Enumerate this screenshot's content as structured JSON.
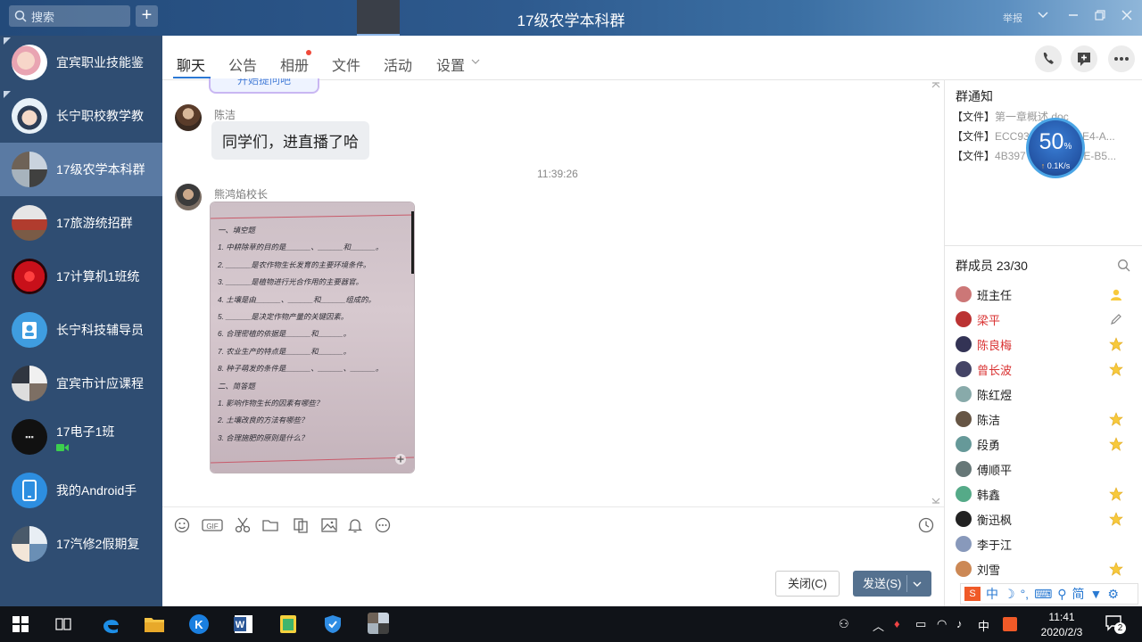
{
  "window": {
    "title": "17级农学本科群",
    "report_label": "举报"
  },
  "search": {
    "placeholder": "搜索"
  },
  "sidebar": {
    "items": [
      {
        "name": "宜宾职业技能鉴"
      },
      {
        "name": "长宁职校教学教"
      },
      {
        "name": "17级农学本科群"
      },
      {
        "name": "17旅游统招群"
      },
      {
        "name": "17计算机1班统"
      },
      {
        "name": "长宁科技辅导员"
      },
      {
        "name": "宜宾市计应课程"
      },
      {
        "name": "17电子1班"
      },
      {
        "name": "我的Android手"
      },
      {
        "name": "17汽修2假期复"
      }
    ]
  },
  "tabs": [
    {
      "label": "聊天"
    },
    {
      "label": "公告"
    },
    {
      "label": "相册"
    },
    {
      "label": "文件"
    },
    {
      "label": "活动"
    },
    {
      "label": "设置"
    }
  ],
  "chat": {
    "top_hint": "开始提问吧",
    "messages": [
      {
        "sender": "陈洁",
        "text": "同学们，进直播了哈"
      },
      {
        "time": "11:39:26"
      },
      {
        "sender": "熊鸿焰校长",
        "image": "handwritten-worksheet"
      }
    ],
    "worksheet_lines": [
      "一、填空题",
      "1. 中耕除草的目的是______、______和______。",
      "2. ______是农作物生长发育的主要环境条件。",
      "3. ______是植物进行光合作用的主要器官。",
      "4. 土壤是由______、______和______组成的。",
      "5. ______是决定作物产量的关键因素。",
      "6. 合理密植的依据是______和______。",
      "7. 农业生产的特点是______和______。",
      "8. 种子萌发的条件是______、______、______。",
      "二、简答题",
      "1. 影响作物生长的因素有哪些？",
      "2. 土壤改良的方法有哪些？",
      "3. 合理施肥的原则是什么？"
    ]
  },
  "composer": {
    "close_label": "关闭(C)",
    "send_label": "发送(S)"
  },
  "notice": {
    "title": "群通知",
    "items": [
      {
        "tag": "【文件】",
        "name": "第一章概述.doc"
      },
      {
        "tag": "【文件】",
        "name": "ECC93",
        "tail": "48E4-A..."
      },
      {
        "tag": "【文件】",
        "name": "4B397",
        "tail": "3BE-B5..."
      }
    ]
  },
  "speed": {
    "percent": "50",
    "percent_unit": "%",
    "rate": "0.1K/s"
  },
  "members": {
    "title": "群成员 23/30",
    "list": [
      {
        "name": "班主任",
        "color": "#222"
      },
      {
        "name": "梁平",
        "color": "#d93232"
      },
      {
        "name": "陈良梅",
        "color": "#d93232"
      },
      {
        "name": "曾长波",
        "color": "#d93232"
      },
      {
        "name": "陈红煜",
        "color": "#222"
      },
      {
        "name": "陈洁",
        "color": "#222"
      },
      {
        "name": "段勇",
        "color": "#222"
      },
      {
        "name": "傅顺平",
        "color": "#222"
      },
      {
        "name": "韩鑫",
        "color": "#222"
      },
      {
        "name": "衡迅枫",
        "color": "#222"
      },
      {
        "name": "李于江",
        "color": "#222"
      },
      {
        "name": "刘雪",
        "color": "#222"
      }
    ]
  },
  "ime": {
    "lang": "中",
    "simplified": "简"
  },
  "taskbar": {
    "time": "11:41",
    "date": "2020/2/3",
    "ime_indicator": "中",
    "notifications": "2"
  },
  "colors": {
    "sidebar": "#2f4d72",
    "active_item": "#5a7aa3",
    "accent": "#2b78d4",
    "send_button": "#55718f",
    "admin_name": "#d93232"
  }
}
